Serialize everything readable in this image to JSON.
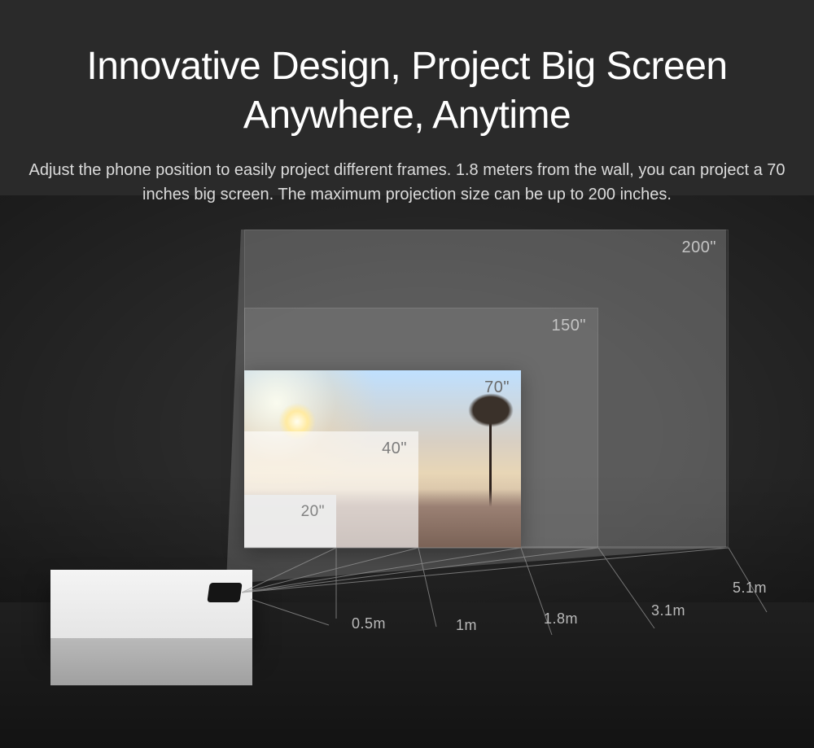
{
  "headline": "Innovative Design, Project Big Screen Anywhere, Anytime",
  "subtext": "Adjust the phone position to easily project different frames. 1.8 meters from the wall, you can project a 70 inches big screen. The maximum projection size can be up to 200 inches.",
  "sizes": {
    "s200": "200\"",
    "s150": "150\"",
    "s70": "70\"",
    "s40": "40\"",
    "s20": "20\""
  },
  "distances": {
    "d05": "0.5m",
    "d1": "1m",
    "d18": "1.8m",
    "d31": "3.1m",
    "d51": "5.1m"
  }
}
